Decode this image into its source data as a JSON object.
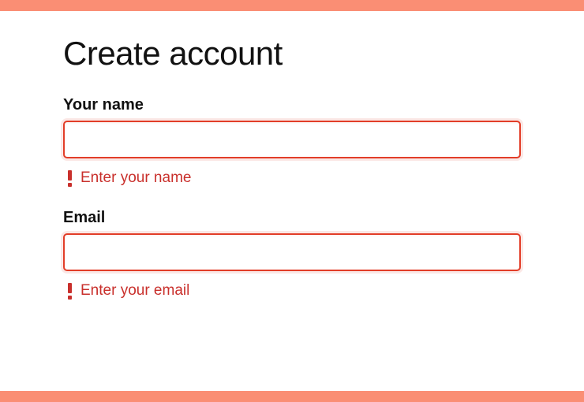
{
  "title": "Create account",
  "fields": {
    "name": {
      "label": "Your name",
      "value": "",
      "error": "Enter your name"
    },
    "email": {
      "label": "Email",
      "value": "",
      "error": "Enter your email"
    }
  }
}
